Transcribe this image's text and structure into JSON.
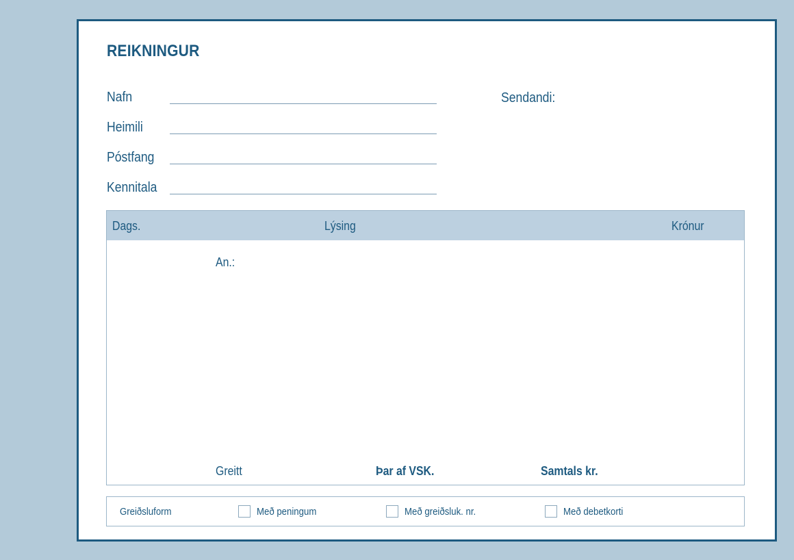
{
  "title": "REIKNINGUR",
  "fields": {
    "nafn": "Nafn",
    "heimili": "Heimili",
    "postfang": "Póstfang",
    "kennitala": "Kennitala"
  },
  "sendandi": "Sendandi:",
  "table": {
    "headers": {
      "dags": "Dags.",
      "lysing": "Lýsing",
      "kronur": "Krónur"
    },
    "an_label": "An.:",
    "footer": {
      "greitt": "Greitt",
      "vsk": "Þar af VSK.",
      "samtals": "Samtals kr."
    }
  },
  "payment": {
    "label": "Greiðsluform",
    "options": {
      "cash": "Með peningum",
      "card_no": "Með greiðsluk. nr.",
      "debit": "Með debetkorti"
    }
  },
  "colors": {
    "text": "#1d5a80",
    "background": "#b3cad9",
    "header_band": "#bcd0e0"
  }
}
